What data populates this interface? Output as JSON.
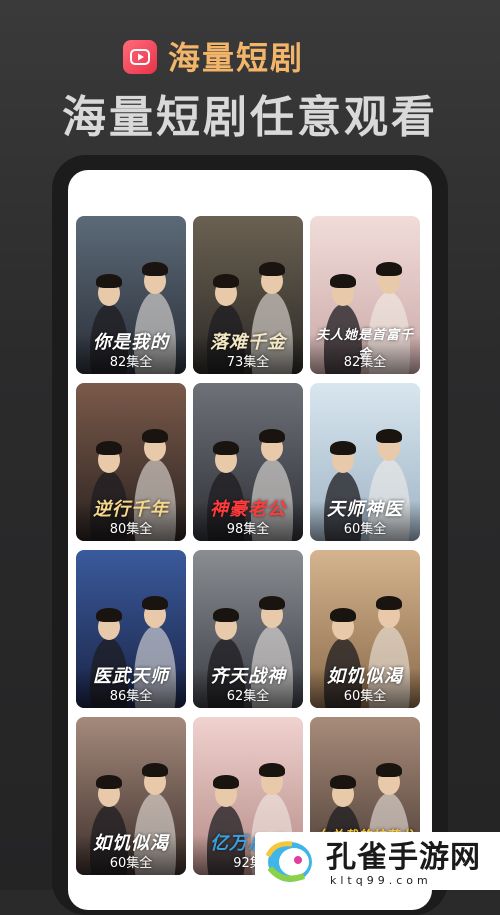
{
  "app": {
    "name": "海量短剧",
    "tagline": "海量短剧任意观看",
    "logo_icon": "play-icon",
    "brand_color": "#f2b56a"
  },
  "dramas": [
    {
      "title_art": "你是我的",
      "episodes": "82集全",
      "bg": [
        "#5c6a78",
        "#2a2f38"
      ],
      "title_color": "#ffffff"
    },
    {
      "title_art": "落难千金",
      "episodes": "73集全",
      "bg": [
        "#6b6152",
        "#2c2a26"
      ],
      "title_color": "#f4e7c4"
    },
    {
      "title_art": "夫人她是首富千金",
      "episodes": "82集全",
      "bg": [
        "#f1dcd9",
        "#c9a8a7"
      ],
      "title_color": "#ffffff"
    },
    {
      "title_art": "逆行千年",
      "episodes": "80集全",
      "bg": [
        "#7a5a4a",
        "#2b2220"
      ],
      "title_color": "#f5d88a"
    },
    {
      "title_art": "神豪老公",
      "episodes": "98集全",
      "bg": [
        "#6e7278",
        "#2e3036"
      ],
      "title_color": "#ff3b3b"
    },
    {
      "title_art": "天师神医",
      "episodes": "60集全",
      "bg": [
        "#d8e6ef",
        "#9fb3c4"
      ],
      "title_color": "#ffffff"
    },
    {
      "title_art": "医武天师",
      "episodes": "86集全",
      "bg": [
        "#3a5a9c",
        "#1a2446"
      ],
      "title_color": "#ffffff"
    },
    {
      "title_art": "齐天战神",
      "episodes": "62集全",
      "bg": [
        "#8a8d92",
        "#3a3d44"
      ],
      "title_color": "#ffffff"
    },
    {
      "title_art": "如饥似渴",
      "episodes": "60集全",
      "bg": [
        "#d5b48f",
        "#8a6a4a"
      ],
      "title_color": "#ffffff"
    },
    {
      "title_art": "如饥似渴",
      "episodes": "60集全",
      "bg": [
        "#a58a7c",
        "#3c2e2a"
      ],
      "title_color": "#ffffff"
    },
    {
      "title_art": "亿万总裁",
      "episodes": "92集",
      "bg": [
        "#f0d2cf",
        "#b48a86"
      ],
      "title_color": "#3aa0e0"
    },
    {
      "title_art": "女总裁的护花龙尊",
      "episodes": "",
      "bg": [
        "#a88c7a",
        "#4a3a34"
      ],
      "title_color": "#f5c63a"
    }
  ],
  "watermark": {
    "text": "孔雀手游网",
    "url": "kltq99.com"
  }
}
